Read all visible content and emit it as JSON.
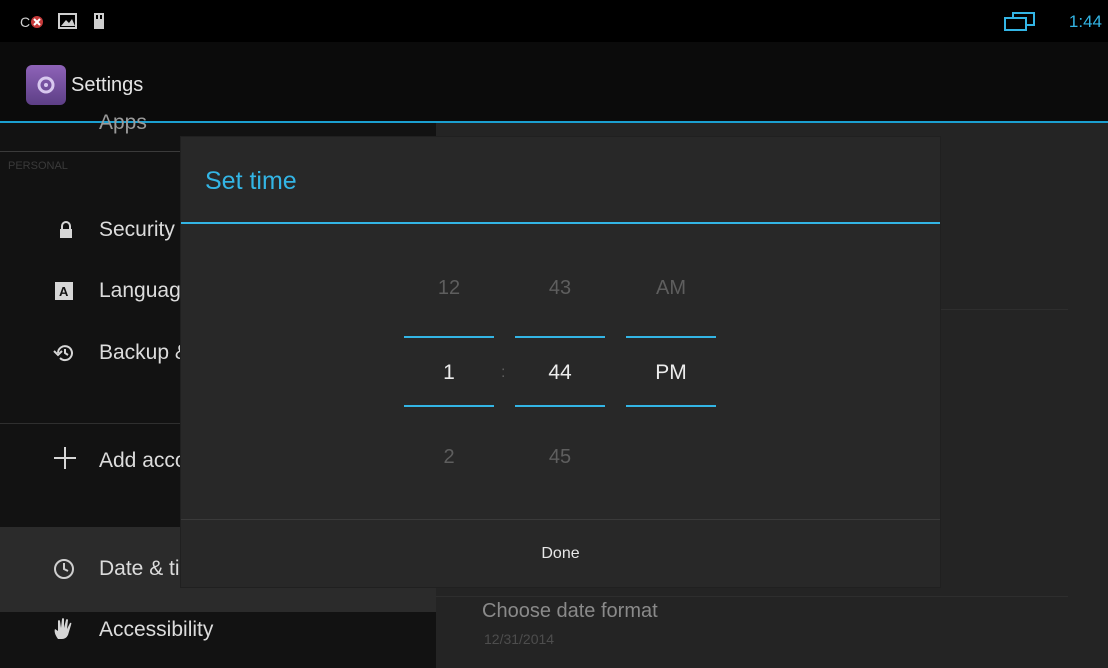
{
  "status": {
    "time": "1:44"
  },
  "app": {
    "title": "Settings"
  },
  "sidebar": {
    "clipped_top_label": "Apps",
    "section_header": "PERSONAL",
    "items": [
      {
        "label": "Security",
        "icon": "lock-icon"
      },
      {
        "label": "Language & input",
        "icon": "keyboard-icon"
      },
      {
        "label": "Backup & reset",
        "icon": "backup-icon"
      },
      {
        "label": "Add account",
        "icon": "plus-icon"
      },
      {
        "label": "Date & time",
        "icon": "clock-icon"
      },
      {
        "label": "Accessibility",
        "icon": "hand-icon"
      }
    ]
  },
  "detail": {
    "choose_date_format": {
      "title": "Choose date format",
      "value": "12/31/2014"
    }
  },
  "dialog": {
    "title": "Set time",
    "hour": {
      "prev": "12",
      "current": "1",
      "next": "2"
    },
    "minute": {
      "prev": "43",
      "current": "44",
      "next": "45"
    },
    "ampm": {
      "prev": "AM",
      "current": "PM"
    },
    "separator": ":",
    "done_label": "Done"
  },
  "colors": {
    "accent": "#33b5e5"
  }
}
